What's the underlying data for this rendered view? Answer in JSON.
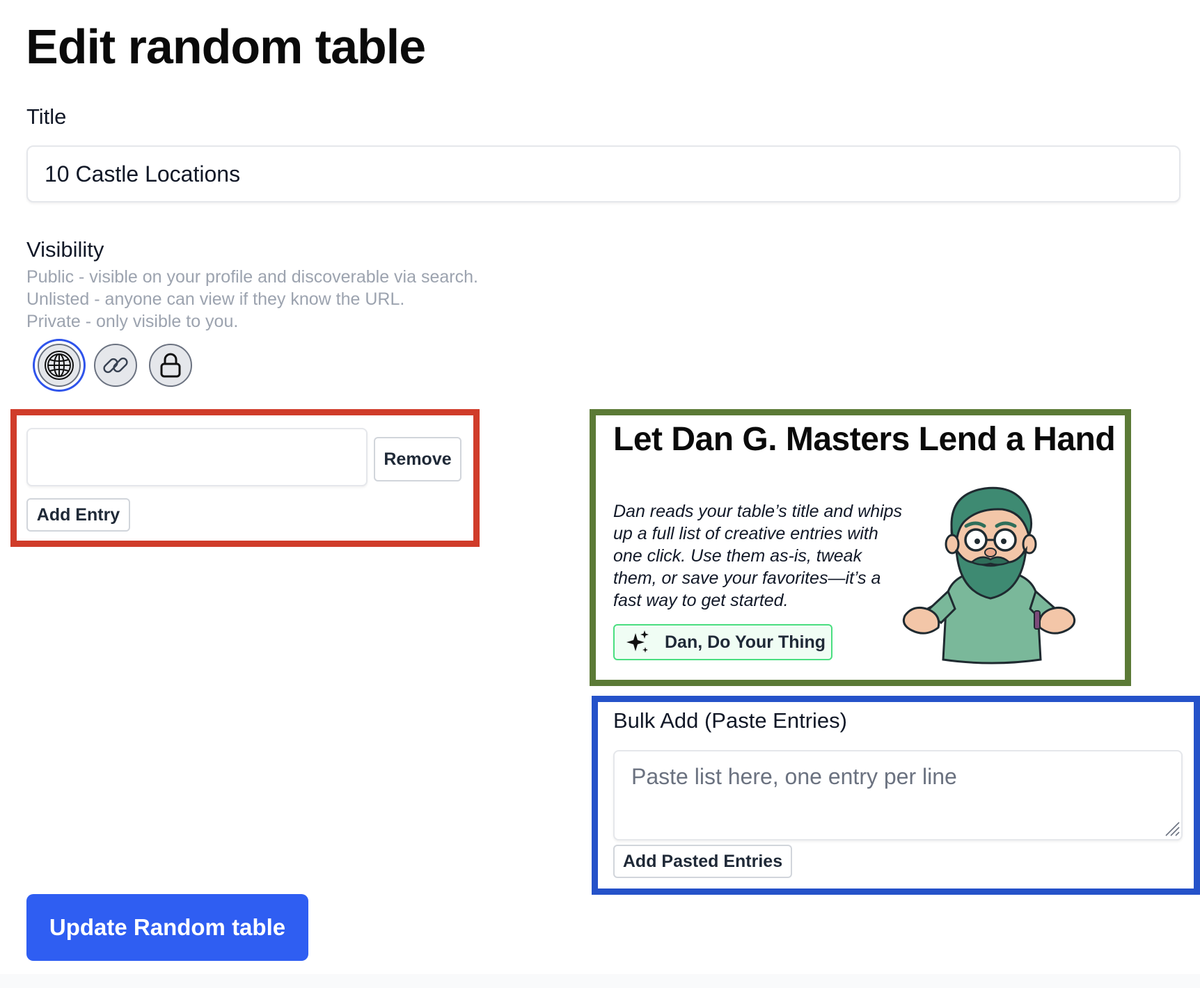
{
  "page": {
    "title": "Edit random table"
  },
  "form": {
    "title_label": "Title",
    "title_value": "10 Castle Locations",
    "visibility": {
      "label": "Visibility",
      "public_desc": "Public - visible on your profile and discoverable via search.",
      "unlisted_desc": "Unlisted - anyone can view if they know the URL.",
      "private_desc": "Private - only visible to you.",
      "options": [
        {
          "icon": "globe-icon",
          "value": "public",
          "selected": true
        },
        {
          "icon": "link-icon",
          "value": "unlisted",
          "selected": false
        },
        {
          "icon": "lock-icon",
          "value": "private",
          "selected": false
        }
      ],
      "selected": "public"
    },
    "entries": {
      "entry_value": "",
      "remove_label": "Remove",
      "add_label": "Add Entry"
    },
    "update_label": "Update Random table"
  },
  "dan_panel": {
    "heading": "Let Dan G. Masters Lend a Hand",
    "description": "Dan reads your table’s title and whips up a full list of creative entries with one click. Use them as-is, tweak them, or save your favorites—it’s a fast way to get started.",
    "button_label": "Dan, Do Your Thing",
    "button_icon": "sparkles-icon",
    "illustration": "bearded-wizard-shrugging"
  },
  "bulk_add": {
    "label": "Bulk Add (Paste Entries)",
    "placeholder": "Paste list here, one entry per line",
    "value": "",
    "button_label": "Add Pasted Entries"
  },
  "annotation_colors": {
    "entries_box": "#d03c2a",
    "dan_box": "#5b7a36",
    "bulk_box": "#2552c9",
    "primary_button": "#2f5ef2"
  }
}
